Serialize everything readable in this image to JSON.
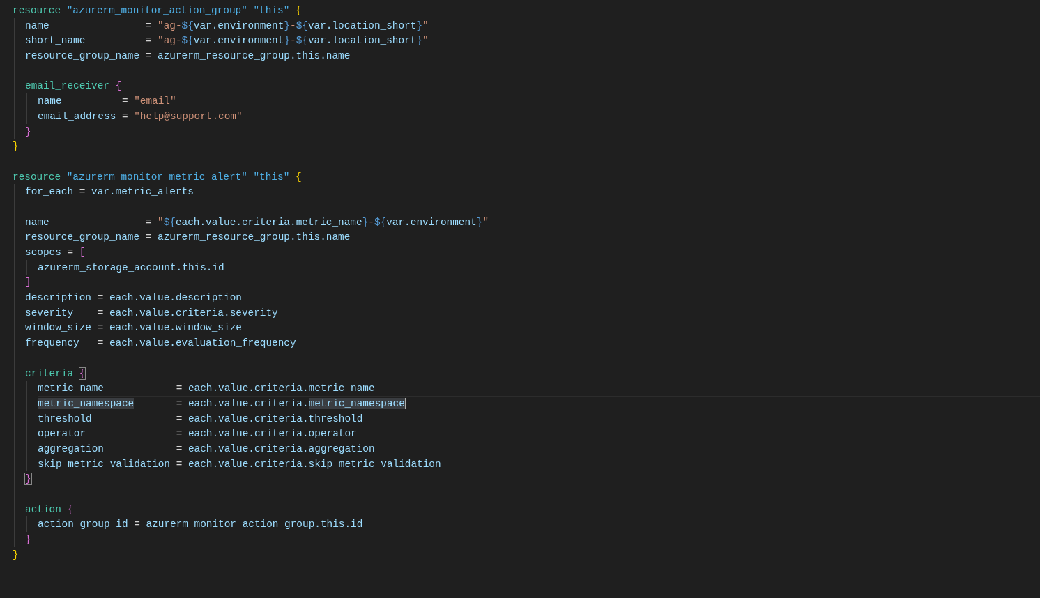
{
  "editor": {
    "lines": [
      {
        "kind": "code",
        "current": false,
        "tokens": [
          {
            "text": "resource ",
            "kind": "block"
          },
          {
            "text": "\"azurerm_monitor_action_group\" ",
            "kind": "label"
          },
          {
            "text": "\"this\" ",
            "kind": "label"
          },
          {
            "text": "{",
            "kind": "brace1"
          }
        ],
        "children": [
          {
            "kind": "code",
            "current": false,
            "tokens": [
              {
                "text": "name                ",
                "kind": "attr"
              },
              {
                "text": "= ",
                "kind": "op"
              },
              {
                "text": "\"ag-",
                "kind": "str"
              },
              {
                "text": "${",
                "kind": "interp"
              },
              {
                "text": "var.environment",
                "kind": "attr"
              },
              {
                "text": "}",
                "kind": "interp"
              },
              {
                "text": "-",
                "kind": "str"
              },
              {
                "text": "${",
                "kind": "interp"
              },
              {
                "text": "var.location_short",
                "kind": "attr"
              },
              {
                "text": "}",
                "kind": "interp"
              },
              {
                "text": "\"",
                "kind": "str"
              }
            ]
          },
          {
            "kind": "code",
            "current": false,
            "tokens": [
              {
                "text": "short_name          ",
                "kind": "attr"
              },
              {
                "text": "= ",
                "kind": "op"
              },
              {
                "text": "\"ag-",
                "kind": "str"
              },
              {
                "text": "${",
                "kind": "interp"
              },
              {
                "text": "var.environment",
                "kind": "attr"
              },
              {
                "text": "}",
                "kind": "interp"
              },
              {
                "text": "-",
                "kind": "str"
              },
              {
                "text": "${",
                "kind": "interp"
              },
              {
                "text": "var.location_short",
                "kind": "attr"
              },
              {
                "text": "}",
                "kind": "interp"
              },
              {
                "text": "\"",
                "kind": "str"
              }
            ]
          },
          {
            "kind": "code",
            "current": false,
            "tokens": [
              {
                "text": "resource_group_name ",
                "kind": "attr"
              },
              {
                "text": "= ",
                "kind": "op"
              },
              {
                "text": "azurerm_resource_group.this.name",
                "kind": "attr"
              }
            ]
          },
          {
            "kind": "blank"
          },
          {
            "kind": "code",
            "current": false,
            "tokens": [
              {
                "text": "email_receiver ",
                "kind": "block"
              },
              {
                "text": "{",
                "kind": "brace2"
              }
            ],
            "children": [
              {
                "kind": "code",
                "current": false,
                "tokens": [
                  {
                    "text": "name          ",
                    "kind": "attr"
                  },
                  {
                    "text": "= ",
                    "kind": "op"
                  },
                  {
                    "text": "\"email\"",
                    "kind": "str"
                  }
                ]
              },
              {
                "kind": "code",
                "current": false,
                "tokens": [
                  {
                    "text": "email_address ",
                    "kind": "attr"
                  },
                  {
                    "text": "= ",
                    "kind": "op"
                  },
                  {
                    "text": "\"help@support.com\"",
                    "kind": "str"
                  }
                ]
              }
            ]
          },
          {
            "kind": "code",
            "current": false,
            "tokens": [
              {
                "text": "}",
                "kind": "brace2"
              }
            ]
          }
        ]
      },
      {
        "kind": "code",
        "current": false,
        "tokens": [
          {
            "text": "}",
            "kind": "brace1"
          }
        ]
      },
      {
        "kind": "blank"
      },
      {
        "kind": "code",
        "current": false,
        "tokens": [
          {
            "text": "resource ",
            "kind": "block"
          },
          {
            "text": "\"azurerm_monitor_metric_alert\" ",
            "kind": "label"
          },
          {
            "text": "\"this\" ",
            "kind": "label"
          },
          {
            "text": "{",
            "kind": "brace1"
          }
        ],
        "children": [
          {
            "kind": "code",
            "current": false,
            "tokens": [
              {
                "text": "for_each ",
                "kind": "attr"
              },
              {
                "text": "= ",
                "kind": "op"
              },
              {
                "text": "var.metric_alerts",
                "kind": "attr"
              }
            ]
          },
          {
            "kind": "blank"
          },
          {
            "kind": "code",
            "current": false,
            "tokens": [
              {
                "text": "name                ",
                "kind": "attr"
              },
              {
                "text": "= ",
                "kind": "op"
              },
              {
                "text": "\"",
                "kind": "str"
              },
              {
                "text": "${",
                "kind": "interp"
              },
              {
                "text": "each.value.criteria.metric_name",
                "kind": "attr"
              },
              {
                "text": "}",
                "kind": "interp"
              },
              {
                "text": "-",
                "kind": "str"
              },
              {
                "text": "${",
                "kind": "interp"
              },
              {
                "text": "var.environment",
                "kind": "attr"
              },
              {
                "text": "}",
                "kind": "interp"
              },
              {
                "text": "\"",
                "kind": "str"
              }
            ]
          },
          {
            "kind": "code",
            "current": false,
            "tokens": [
              {
                "text": "resource_group_name ",
                "kind": "attr"
              },
              {
                "text": "= ",
                "kind": "op"
              },
              {
                "text": "azurerm_resource_group.this.name",
                "kind": "attr"
              }
            ]
          },
          {
            "kind": "code",
            "current": false,
            "tokens": [
              {
                "text": "scopes ",
                "kind": "attr"
              },
              {
                "text": "= ",
                "kind": "op"
              },
              {
                "text": "[",
                "kind": "brace2"
              }
            ],
            "children": [
              {
                "kind": "code",
                "current": false,
                "tokens": [
                  {
                    "text": "azurerm_storage_account.this.id",
                    "kind": "attr"
                  }
                ]
              }
            ]
          },
          {
            "kind": "code",
            "current": false,
            "tokens": [
              {
                "text": "]",
                "kind": "brace2"
              }
            ]
          },
          {
            "kind": "code",
            "current": false,
            "tokens": [
              {
                "text": "description ",
                "kind": "attr"
              },
              {
                "text": "= ",
                "kind": "op"
              },
              {
                "text": "each.value.description",
                "kind": "attr"
              }
            ]
          },
          {
            "kind": "code",
            "current": false,
            "tokens": [
              {
                "text": "severity    ",
                "kind": "attr"
              },
              {
                "text": "= ",
                "kind": "op"
              },
              {
                "text": "each.value.criteria.severity",
                "kind": "attr"
              }
            ]
          },
          {
            "kind": "code",
            "current": false,
            "tokens": [
              {
                "text": "window_size ",
                "kind": "attr"
              },
              {
                "text": "= ",
                "kind": "op"
              },
              {
                "text": "each.value.window_size",
                "kind": "attr"
              }
            ]
          },
          {
            "kind": "code",
            "current": false,
            "tokens": [
              {
                "text": "frequency   ",
                "kind": "attr"
              },
              {
                "text": "= ",
                "kind": "op"
              },
              {
                "text": "each.value.evaluation_frequency",
                "kind": "attr"
              }
            ]
          },
          {
            "kind": "blank"
          },
          {
            "kind": "code",
            "current": false,
            "tokens": [
              {
                "text": "criteria ",
                "kind": "block",
                "matched": false
              },
              {
                "text": "{",
                "kind": "brace2",
                "matched": true
              }
            ],
            "children": [
              {
                "kind": "code",
                "current": false,
                "tokens": [
                  {
                    "text": "metric_name            ",
                    "kind": "attr"
                  },
                  {
                    "text": "= ",
                    "kind": "op"
                  },
                  {
                    "text": "each.value.criteria.metric_name",
                    "kind": "attr"
                  }
                ]
              },
              {
                "kind": "code",
                "current": true,
                "tokens": [
                  {
                    "text": "metric_namespace",
                    "kind": "attr",
                    "highlighted": true,
                    "cursor": false
                  },
                  {
                    "text": "       = ",
                    "kind": "op",
                    "highlighted": false,
                    "cursor": false
                  },
                  {
                    "text": "each.value.criteria.",
                    "kind": "attr",
                    "highlighted": false,
                    "cursor": false
                  },
                  {
                    "text": "metric_namespace",
                    "kind": "attr",
                    "highlighted": true,
                    "cursor": true
                  }
                ]
              },
              {
                "kind": "code",
                "current": false,
                "tokens": [
                  {
                    "text": "threshold              ",
                    "kind": "attr"
                  },
                  {
                    "text": "= ",
                    "kind": "op"
                  },
                  {
                    "text": "each.value.criteria.threshold",
                    "kind": "attr"
                  }
                ]
              },
              {
                "kind": "code",
                "current": false,
                "tokens": [
                  {
                    "text": "operator               ",
                    "kind": "attr"
                  },
                  {
                    "text": "= ",
                    "kind": "op"
                  },
                  {
                    "text": "each.value.criteria.operator",
                    "kind": "attr"
                  }
                ]
              },
              {
                "kind": "code",
                "current": false,
                "tokens": [
                  {
                    "text": "aggregation            ",
                    "kind": "attr"
                  },
                  {
                    "text": "= ",
                    "kind": "op"
                  },
                  {
                    "text": "each.value.criteria.aggregation",
                    "kind": "attr"
                  }
                ]
              },
              {
                "kind": "code",
                "current": false,
                "tokens": [
                  {
                    "text": "skip_metric_validation ",
                    "kind": "attr"
                  },
                  {
                    "text": "= ",
                    "kind": "op"
                  },
                  {
                    "text": "each.value.criteria.skip_metric_validation",
                    "kind": "attr"
                  }
                ]
              }
            ]
          },
          {
            "kind": "code",
            "current": false,
            "tokens": [
              {
                "text": "}",
                "kind": "brace2",
                "matched": true
              }
            ]
          },
          {
            "kind": "blank"
          },
          {
            "kind": "code",
            "current": false,
            "tokens": [
              {
                "text": "action ",
                "kind": "block"
              },
              {
                "text": "{",
                "kind": "brace2"
              }
            ],
            "children": [
              {
                "kind": "code",
                "current": false,
                "tokens": [
                  {
                    "text": "action_group_id ",
                    "kind": "attr"
                  },
                  {
                    "text": "= ",
                    "kind": "op"
                  },
                  {
                    "text": "azurerm_monitor_action_group.this.id",
                    "kind": "attr"
                  }
                ]
              }
            ]
          },
          {
            "kind": "code",
            "current": false,
            "tokens": [
              {
                "text": "}",
                "kind": "brace2"
              }
            ]
          }
        ]
      },
      {
        "kind": "code",
        "current": false,
        "tokens": [
          {
            "text": "}",
            "kind": "brace1"
          }
        ]
      }
    ]
  }
}
